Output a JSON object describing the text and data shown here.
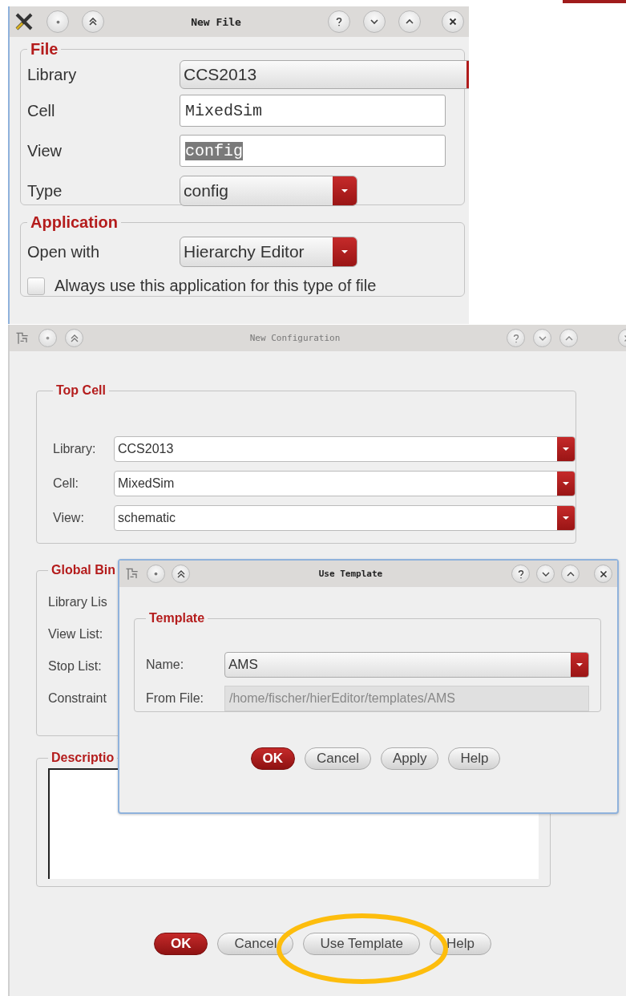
{
  "new_file": {
    "title": "New File",
    "file_group": {
      "title": "File",
      "rows": [
        {
          "label": "Library",
          "kind": "combo",
          "value": "CCS2013"
        },
        {
          "label": "Cell",
          "kind": "input",
          "value": "MixedSim",
          "text_selected": false
        },
        {
          "label": "View",
          "kind": "input",
          "value": "config",
          "text_selected": true
        },
        {
          "label": "Type",
          "kind": "dropdown",
          "value": "config"
        }
      ]
    },
    "application_group": {
      "title": "Application",
      "rows": [
        {
          "label": "Open with",
          "kind": "dropdown",
          "value": "Hierarchy Editor"
        }
      ],
      "checkbox": {
        "label": "Always use this application for this type of file",
        "checked": false
      }
    }
  },
  "new_configuration": {
    "title": "New Configuration",
    "top_cell": {
      "title": "Top Cell",
      "rows": [
        {
          "label": "Library:",
          "value": "CCS2013"
        },
        {
          "label": "Cell:",
          "value": "MixedSim"
        },
        {
          "label": "View:",
          "value": "schematic"
        }
      ]
    },
    "global_bindings": {
      "title": "Global Bin",
      "labels": [
        "Library Lis",
        "View List:",
        "Stop List:",
        "Constraint"
      ]
    },
    "description": {
      "title": "Descriptio"
    },
    "buttons": [
      {
        "label": "OK",
        "kind": "primary"
      },
      {
        "label": "Cancel",
        "kind": "normal"
      },
      {
        "label": "Use Template",
        "kind": "normal"
      },
      {
        "label": "Help",
        "kind": "normal"
      }
    ]
  },
  "use_template": {
    "title": "Use Template",
    "group": {
      "title": "Template",
      "rows": [
        {
          "label": "Name:",
          "kind": "dropdown",
          "value": "AMS"
        },
        {
          "label": "From File:",
          "kind": "readonly",
          "value": "/home/fischer/hierEditor/templates/AMS"
        }
      ]
    },
    "buttons": [
      {
        "label": "OK",
        "kind": "primary"
      },
      {
        "label": "Cancel",
        "kind": "normal"
      },
      {
        "label": "Apply",
        "kind": "normal"
      },
      {
        "label": "Help",
        "kind": "normal"
      }
    ]
  }
}
